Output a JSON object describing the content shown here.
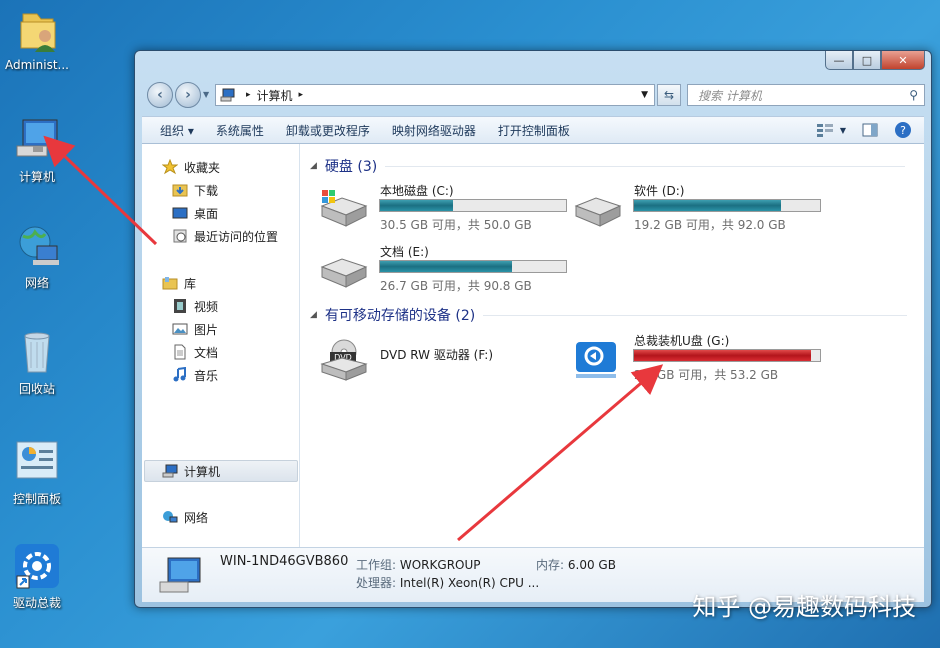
{
  "desktop": {
    "icons": [
      {
        "label": "Administ...",
        "icon": "user-folder-icon"
      },
      {
        "label": "计算机",
        "icon": "computer-icon"
      },
      {
        "label": "网络",
        "icon": "network-icon"
      },
      {
        "label": "回收站",
        "icon": "recycle-bin-icon"
      },
      {
        "label": "控制面板",
        "icon": "control-panel-icon"
      },
      {
        "label": "驱动总裁",
        "icon": "driver-app-icon"
      }
    ]
  },
  "window": {
    "caption": {
      "minimize": "—",
      "maximize": "□",
      "close": "✕"
    },
    "address": {
      "separator_1": "▸",
      "location": "计算机",
      "separator_2": "▸"
    },
    "search": {
      "placeholder": "搜索 计算机"
    },
    "toolbar": {
      "organize": "组织 ▾",
      "system_properties": "系统属性",
      "uninstall": "卸载或更改程序",
      "map_drive": "映射网络驱动器",
      "control_panel": "打开控制面板"
    },
    "sidebar": {
      "favorites": "收藏夹",
      "downloads": "下载",
      "desktop": "桌面",
      "recent": "最近访问的位置",
      "libraries": "库",
      "videos": "视频",
      "pictures": "图片",
      "documents": "文档",
      "music": "音乐",
      "computer": "计算机",
      "network": "网络"
    },
    "groups": {
      "hard_disks": "硬盘 (3)",
      "removable": "有可移动存储的设备 (2)"
    },
    "drives": {
      "c": {
        "name": "本地磁盘 (C:)",
        "free": "30.5 GB 可用，共 50.0 GB",
        "used_fraction": 0.39
      },
      "d": {
        "name": "软件 (D:)",
        "free": "19.2 GB 可用，共 92.0 GB",
        "used_fraction": 0.79
      },
      "e": {
        "name": "文档 (E:)",
        "free": "26.7 GB 可用，共 90.8 GB",
        "used_fraction": 0.71
      },
      "f": {
        "name": "DVD RW 驱动器 (F:)"
      },
      "g": {
        "name": "总裁装机U盘 (G:)",
        "free": "2.6 GB 可用，共 53.2 GB",
        "used_fraction": 0.95
      }
    },
    "details": {
      "hostname": "WIN-1ND46GVB860",
      "workgroup_label": "工作组:",
      "workgroup_value": "WORKGROUP",
      "memory_label": "内存:",
      "memory_value": "6.00 GB",
      "cpu_label": "处理器:",
      "cpu_value": "Intel(R) Xeon(R) CPU ..."
    }
  },
  "watermark": "知乎 @易趣数码科技",
  "colors": {
    "arrow": "#e8383d",
    "progress": "#1b6f82",
    "progress_full": "#b3151b",
    "group_header": "#1e3287"
  }
}
